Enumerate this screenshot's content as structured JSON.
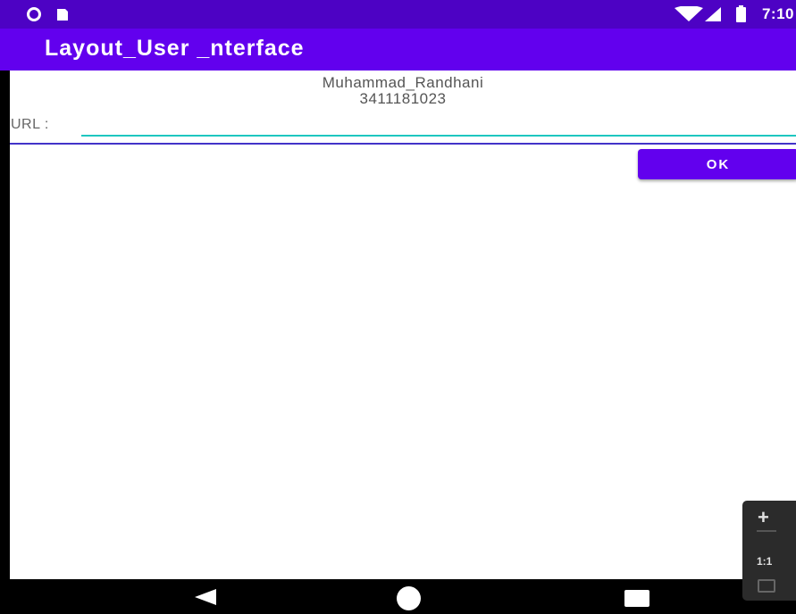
{
  "status_bar": {
    "time": "7:10",
    "icons": [
      "circle-indicator-icon",
      "sd-card-icon",
      "wifi-icon",
      "signal-icon",
      "battery-icon"
    ]
  },
  "app_bar": {
    "title": "Layout_User _nterface"
  },
  "content": {
    "student_name": "Muhammad_Randhani",
    "student_id": "3411181023",
    "url_label": "URL :",
    "url_value": "",
    "ok_label": "OK"
  },
  "nav_bar": {
    "icons": [
      "back-icon",
      "home-icon",
      "recents-icon"
    ]
  },
  "zoom_controls": {
    "zoom_in": "+",
    "zoom_reset": "1:1"
  },
  "colors": {
    "status_bar": "#4d02c4",
    "primary": "#6200ee",
    "input_underline": "#1ec6c0"
  }
}
